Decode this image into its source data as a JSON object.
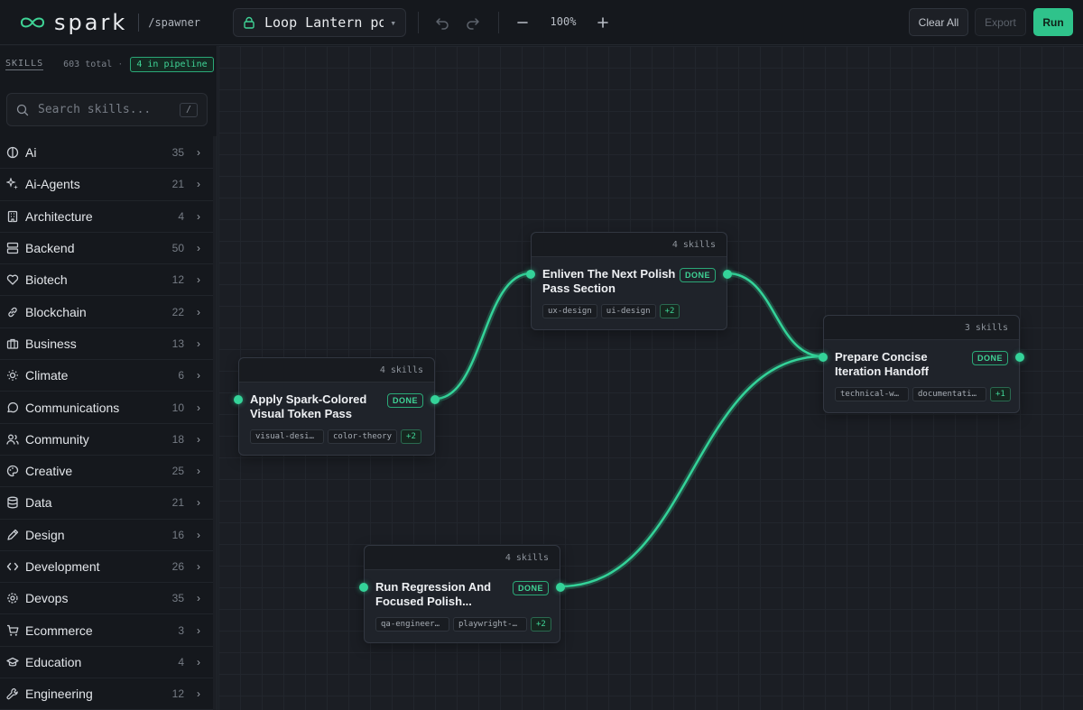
{
  "app": {
    "brand": "spark",
    "subtitle": "/spawner"
  },
  "toolbar": {
    "project_name": "Loop Lantern po...",
    "zoom": "100%",
    "clear_label": "Clear All",
    "export_label": "Export",
    "run_label": "Run"
  },
  "sidebar": {
    "title": "SKILLS",
    "total": "603 total",
    "separator": "·",
    "pipeline_badge": "4 in pipeline",
    "search_placeholder": "Search skills...",
    "search_shortcut": "/",
    "categories": [
      {
        "label": "Ai",
        "count": "35",
        "icon": "brain-icon"
      },
      {
        "label": "Ai-Agents",
        "count": "21",
        "icon": "sparkles-icon"
      },
      {
        "label": "Architecture",
        "count": "4",
        "icon": "building-icon"
      },
      {
        "label": "Backend",
        "count": "50",
        "icon": "server-icon"
      },
      {
        "label": "Biotech",
        "count": "12",
        "icon": "heart-icon"
      },
      {
        "label": "Blockchain",
        "count": "22",
        "icon": "link-icon"
      },
      {
        "label": "Business",
        "count": "13",
        "icon": "briefcase-icon"
      },
      {
        "label": "Climate",
        "count": "6",
        "icon": "sun-icon"
      },
      {
        "label": "Communications",
        "count": "10",
        "icon": "chat-icon"
      },
      {
        "label": "Community",
        "count": "18",
        "icon": "users-icon"
      },
      {
        "label": "Creative",
        "count": "25",
        "icon": "palette-icon"
      },
      {
        "label": "Data",
        "count": "21",
        "icon": "database-icon"
      },
      {
        "label": "Design",
        "count": "16",
        "icon": "pen-icon"
      },
      {
        "label": "Development",
        "count": "26",
        "icon": "code-icon"
      },
      {
        "label": "Devops",
        "count": "35",
        "icon": "gear-icon"
      },
      {
        "label": "Ecommerce",
        "count": "3",
        "icon": "cart-icon"
      },
      {
        "label": "Education",
        "count": "4",
        "icon": "graduation-cap-icon"
      },
      {
        "label": "Engineering",
        "count": "12",
        "icon": "wrench-icon"
      }
    ]
  },
  "nodes": [
    {
      "title": "Apply Spark-Colored Visual Token Pass",
      "skills": "4 skills",
      "status": "DONE",
      "tags": [
        "visual-design",
        "color-theory"
      ],
      "more": "+2"
    },
    {
      "title": "Enliven The Next Polish Pass Section",
      "skills": "4 skills",
      "status": "DONE",
      "tags": [
        "ux-design",
        "ui-design"
      ],
      "more": "+2"
    },
    {
      "title": "Prepare Concise Iteration Handoff",
      "skills": "3 skills",
      "status": "DONE",
      "tags": [
        "technical-wr...",
        "documentation..."
      ],
      "more": "+1"
    },
    {
      "title": "Run Regression And Focused Polish...",
      "skills": "4 skills",
      "status": "DONE",
      "tags": [
        "qa-engineeri...",
        "playwright-te..."
      ],
      "more": "+2"
    }
  ],
  "colors": {
    "accent": "#34d399",
    "run_button": "#2fc38b",
    "background": "#181b21"
  }
}
